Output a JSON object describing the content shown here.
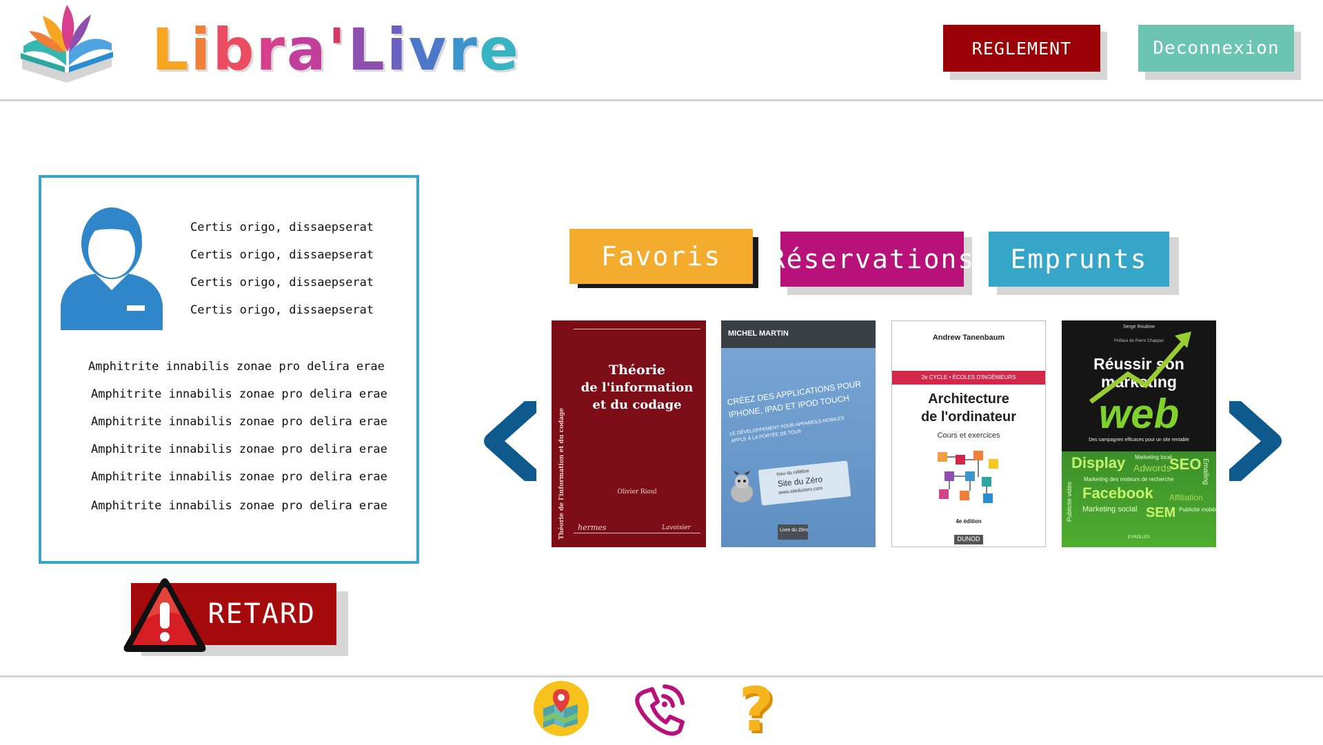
{
  "header": {
    "brand_parts": [
      {
        "text": "L",
        "color": "#f6a623"
      },
      {
        "text": "i",
        "color": "#f07f3a"
      },
      {
        "text": "b",
        "color": "#ea4d62"
      },
      {
        "text": "r",
        "color": "#d63f8b"
      },
      {
        "text": "a",
        "color": "#c13f9b"
      },
      {
        "text": "'",
        "color": "#d23a63"
      },
      {
        "text": "L",
        "color": "#8e4fb0"
      },
      {
        "text": "i",
        "color": "#6a61c0"
      },
      {
        "text": "v",
        "color": "#4d78c9"
      },
      {
        "text": "r",
        "color": "#3c94cc"
      },
      {
        "text": "e",
        "color": "#37b3c1"
      }
    ],
    "reglement_label": "REGLEMENT",
    "deconnexion_label": "Deconnexion"
  },
  "colors": {
    "reglement": "#9a0006",
    "deconnexion": "#6cc4b3",
    "card_border": "#3ba3c4",
    "avatar": "#2f86c8",
    "retard": "#a50a0d",
    "tab_favoris": "#f4ac2f",
    "tab_reservations": "#b8127a",
    "tab_emprunts": "#35a6c8",
    "arrow": "#0f5a8c"
  },
  "profile": {
    "lines": [
      "Certis origo, dissaepserat",
      "Certis origo, dissaepserat",
      "Certis origo, dissaepserat",
      "Certis origo, dissaepserat"
    ],
    "details": [
      "Amphitrite  innabilis zonae pro delira erae",
      "Amphitrite  innabilis zonae pro delira erae",
      "Amphitrite  innabilis zonae pro delira erae",
      "Amphitrite  innabilis zonae pro delira erae",
      "Amphitrite  innabilis zonae pro delira erae",
      "Amphitrite  innabilis zonae pro delira erae"
    ]
  },
  "retard_label": "RETARD",
  "tabs": [
    {
      "label": "Favoris"
    },
    {
      "label": "Réservations"
    },
    {
      "label": "Emprunts"
    }
  ],
  "books": [
    {
      "title_lines": [
        "Théorie",
        "de l'information",
        "et du codage"
      ],
      "spine": "Théorie de l'information et du codage",
      "author": "Olivier Rioul",
      "publisher_left": "hermes",
      "publisher_right": "Lavoisier"
    },
    {
      "author": "MICHEL MARTIN",
      "title_lines": [
        "CRÉEZ DES APPLICATIONS POUR",
        "IPHONE, IPAD ET IPOD TOUCH"
      ],
      "subtitle_lines": [
        "LE DÉVELOPPEMENT POUR APPAREILS MOBILES",
        "APPLE À LA PORTÉE DE TOUS"
      ],
      "badge_lines": [
        "Issu du célèbre",
        "Site du Zéro",
        "www.siteduzero.com"
      ],
      "logo": "Livre du Zéro"
    },
    {
      "author": "Andrew Tanenbaum",
      "band": "2e CYCLE • ÉCOLES D'INGÉNIEURS",
      "title_lines": [
        "Architecture",
        "de l'ordinateur"
      ],
      "subtitle": "Cours et exercices",
      "edition": "4e édition",
      "publisher": "DUNOD"
    },
    {
      "author": "Serge Roukine",
      "title_lines": [
        "Réussir son",
        "marketing"
      ],
      "big_word": "web",
      "tagline": "Des campagnes efficaces pour un site rentable",
      "preface": "Préface de Pierre Chappaz",
      "keywords": [
        "Display",
        "SEO",
        "Marketing local",
        "Adwords",
        "Marketing des moteurs de recherche",
        "Facebook",
        "Affiliation",
        "Marketing social",
        "SEM",
        "Publicité mobile",
        "Publicité vidéo",
        "Emailing"
      ],
      "publisher": "EYROLLES"
    }
  ],
  "footer": {
    "icons": [
      "map-icon",
      "phone-icon",
      "help-icon"
    ],
    "help_symbol": "?"
  }
}
